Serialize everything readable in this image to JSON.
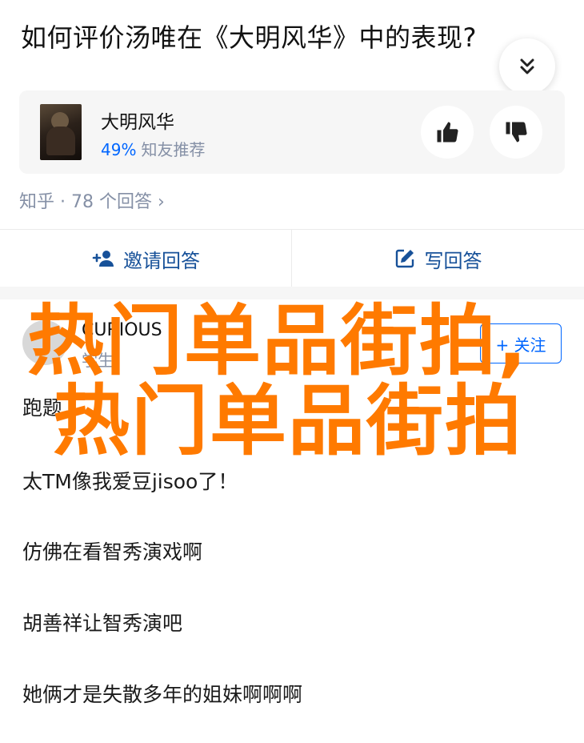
{
  "question": {
    "title": "如何评价汤唯在《大明风华》中的表现?"
  },
  "card": {
    "title": "大明风华",
    "percent": "49%",
    "recommend_label": "知友推荐"
  },
  "meta": {
    "text": "知乎 · 78 个回答 ›"
  },
  "actions": {
    "invite_label": "邀请回答",
    "write_label": "写回答"
  },
  "author": {
    "name": "CURIOUS",
    "bio": "学生",
    "follow_label": "+ 关注"
  },
  "answer": {
    "lines": [
      "跑题",
      "太TM像我爱豆jisoo了！",
      "仿佛在看智秀演戏啊",
      "胡善祥让智秀演吧",
      "她俩才是失散多年的姐妹啊啊啊"
    ]
  },
  "watermark": {
    "line1": "热门单品街拍,",
    "line2": "热门单品街拍"
  },
  "colors": {
    "accent": "#0066ff",
    "link": "#175199",
    "meta": "#8590a6",
    "watermark": "#ff7a00"
  }
}
